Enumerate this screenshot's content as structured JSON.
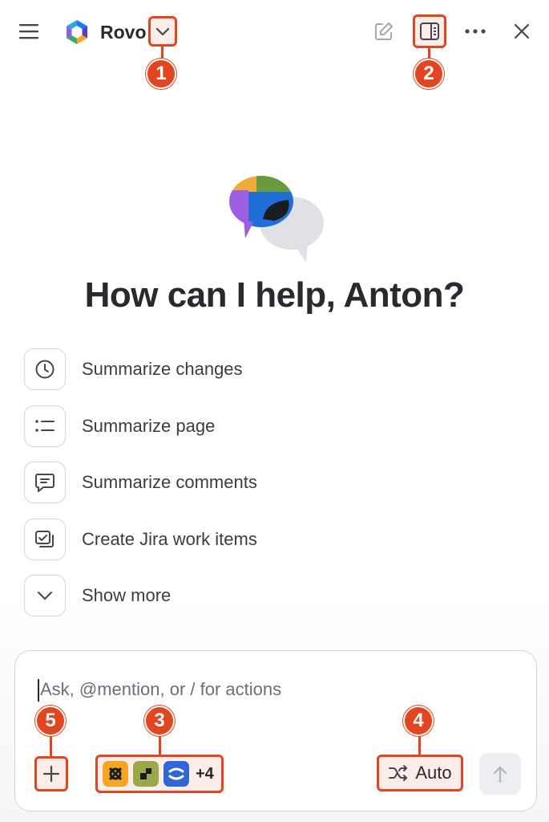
{
  "header": {
    "app_name": "Rovo",
    "icons": {
      "menu": "hamburger-icon",
      "logo": "rovo-logo-icon",
      "dropdown": "chevron-down-icon",
      "new_chat": "edit-icon",
      "panel": "panel-layout-icon",
      "more": "more-icon",
      "close": "close-icon"
    }
  },
  "annotations": [
    "1",
    "2",
    "3",
    "4",
    "5"
  ],
  "accent_color": "#e2451f",
  "greeting": "How can I help, Anton?",
  "suggestions": [
    {
      "label": "Summarize changes",
      "icon": "clock-icon"
    },
    {
      "label": "Summarize page",
      "icon": "list-icon"
    },
    {
      "label": "Summarize comments",
      "icon": "comment-icon"
    },
    {
      "label": "Create Jira work items",
      "icon": "create-issue-icon"
    },
    {
      "label": "Show more",
      "icon": "chevron-down-icon"
    }
  ],
  "composer": {
    "placeholder": "Ask, @mention, or / for actions",
    "sources_more": "+4",
    "mode_label": "Auto",
    "icons": {
      "add": "plus-icon",
      "sources": [
        "app-icon-orange",
        "app-icon-olive",
        "app-icon-blue"
      ],
      "mode": "shuffle-icon",
      "send": "arrow-up-icon"
    }
  }
}
